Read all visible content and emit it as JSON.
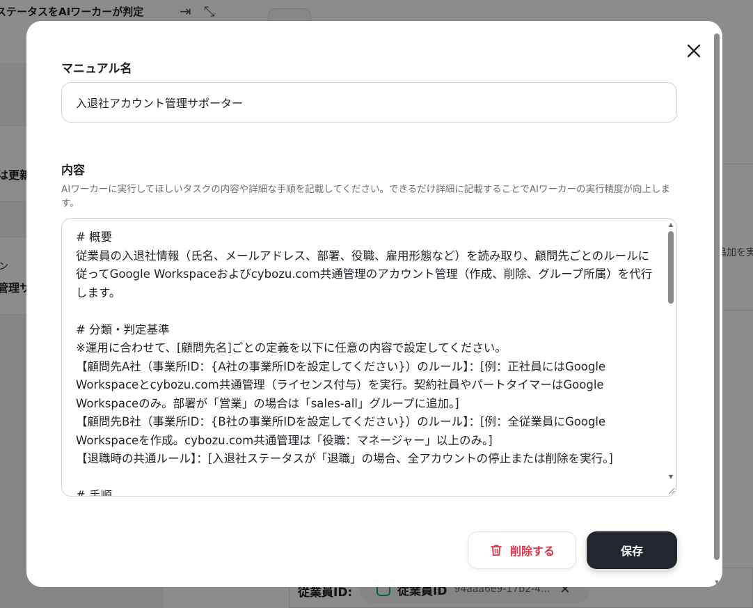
{
  "background": {
    "title_fragment": "ステータスをAIワーカーが判定",
    "left_items": [
      "は更新",
      "ン",
      "管理サポ"
    ],
    "right_fragment": "追加を実",
    "employee_label": "従業員ID:",
    "chip_name": "従業員ID",
    "chip_id": "94aaa6e9-17b2-4..."
  },
  "modal": {
    "manual_name_label": "マニュアル名",
    "manual_name_value": "入退社アカウント管理サポーター",
    "content_label": "内容",
    "content_help": "AIワーカーに実行してほしいタスクの内容や詳細な手順を記載してください。できるだけ詳細に記載することでAIワーカーの実行精度が向上します。",
    "content_value": "# 概要\n従業員の入退社情報（氏名、メールアドレス、部署、役職、雇用形態など）を読み取り、顧問先ごとのルールに従ってGoogle Workspaceおよびcybozu.com共通管理のアカウント管理（作成、削除、グループ所属）を代行します。\n\n# 分類・判定基準\n※運用に合わせて、[顧問先名]ごとの定義を以下に任意の内容で設定してください。\n【顧問先A社（事業所ID：{A社の事業所IDを設定してください}）のルール】：[例：正社員にはGoogle Workspaceとcybozu.com共通管理（ライセンス付与）を実行。契約社員やパートタイマーはGoogle Workspaceのみ。部署が「営業」の場合は「sales-all」グループに追加。]\n【顧問先B社（事業所ID：{B社の事業所IDを設定してください}）のルール】：[例：全従業員にGoogle Workspaceを作成。cybozu.com共通管理は「役職：マネージャー」以上のみ。]\n【退職時の共通ルール】：[入退社ステータスが「退職」の場合、全アカウントの停止または削除を実行。]\n\n# 手順",
    "delete_label": "削除する",
    "save_label": "保存"
  },
  "colors": {
    "accent_danger": "#e0314b",
    "primary_button": "#22262e",
    "overlay": "rgba(0,0,0,0.45)"
  },
  "icons": {
    "close": "close-icon",
    "trash": "trash-icon"
  }
}
